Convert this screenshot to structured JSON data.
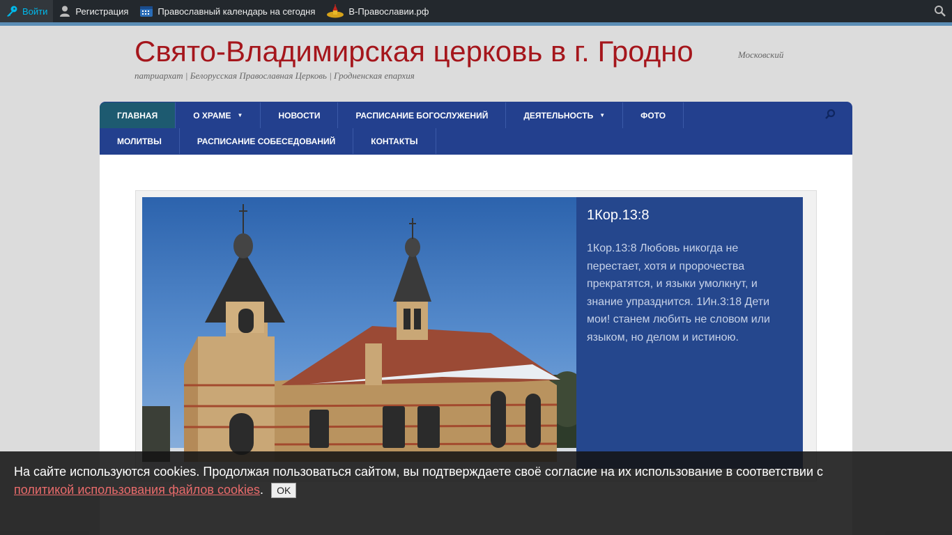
{
  "adminbar": {
    "login": "Войти",
    "register": "Регистрация",
    "calendar": "Православный календарь на сегодня",
    "site_link": "В-Православии.рф",
    "icons": [
      "key-icon",
      "user-icon",
      "calendar-icon",
      "church-logo-icon",
      "search-icon"
    ]
  },
  "header": {
    "title": "Свято-Владимирская церковь в г. Гродно",
    "description_part1": "Московский",
    "description_part2": "патриархат | Белорусская Православная Церковь | Гродненская епархия"
  },
  "nav": {
    "row1": [
      "Главная",
      "О храме",
      "Новости",
      "Расписание богослужений",
      "Деятельность",
      "Фото"
    ],
    "row2": [
      "Молитвы",
      "Расписание собеседований",
      "Контакты"
    ]
  },
  "slider": {
    "title": "1Кор.13:8",
    "body": "1Кор.13:8 Любовь никогда не перестает, хотя и пророчества прекратятся, и языки умолкнут, и знание упразднится. 1Ин.3:18 Дети мои! станем любить не словом или языком, но делом и истиною."
  },
  "cookie": {
    "text": "На сайте используются cookies. Продолжая пользоваться сайтом, вы подтверждаете своё согласие на их использование в соответствии с",
    "link": "политикой использования файлов cookies",
    "ok": "OK"
  },
  "colors": {
    "title": "#a5161c",
    "nav": "#23408e",
    "nav_current": "#1d5a70",
    "slide_panel": "#25478d",
    "adminbar": "#23282d"
  }
}
